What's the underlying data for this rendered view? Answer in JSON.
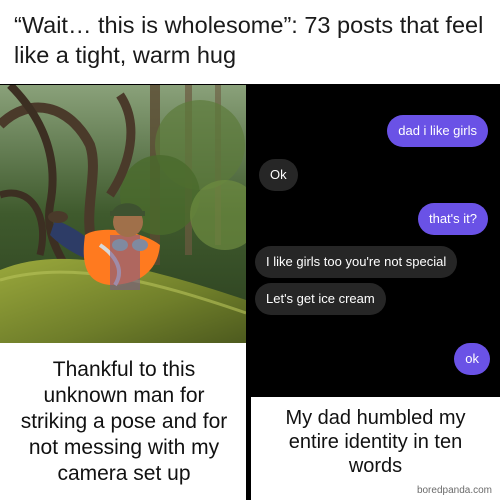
{
  "headline": "“Wait… this is wholesome”: 73 posts that feel like a tight, warm hug",
  "left_panel": {
    "caption": "Thankful to this unknown man for striking a pose and for not messing with my camera set up"
  },
  "right_panel": {
    "messages": [
      {
        "text": "dad i like girls",
        "side": "out"
      },
      {
        "text": "Ok",
        "side": "in"
      },
      {
        "text": "that's it?",
        "side": "out"
      },
      {
        "text": "I like girls too you're not special",
        "side": "in"
      },
      {
        "text": "Let's get ice cream",
        "side": "in"
      },
      {
        "text": "ok",
        "side": "out"
      }
    ],
    "caption": "My dad humbled my entire identity in ten words"
  },
  "watermark": "boredpanda.com",
  "colors": {
    "outgoing_bubble": "#6a52e6",
    "incoming_bubble": "#262626",
    "chat_background": "#000000"
  }
}
